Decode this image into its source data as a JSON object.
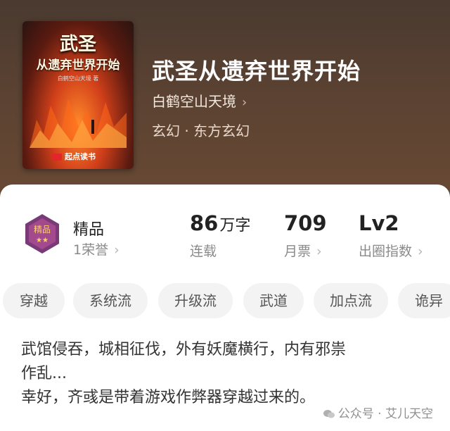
{
  "book": {
    "title": "武圣从遗弃世界开始",
    "author": "白鹤空山天境",
    "genre": "玄幻 · 东方玄幻",
    "cover": {
      "title_line1": "武圣",
      "title_line2": "从遗弃世界开始",
      "author": "白鹤空山天境 著",
      "publisher": "起点读书"
    }
  },
  "stats": {
    "badge_label": "精品",
    "honor": "1荣誉",
    "word_count_value": "86",
    "word_count_unit": "万字",
    "word_count_status": "连载",
    "monthly_tickets_value": "709",
    "monthly_tickets_label": "月票",
    "level_value": "Lv2",
    "level_label": "出圈指数"
  },
  "tags": [
    "穿越",
    "系统流",
    "升级流",
    "武道",
    "加点流",
    "诡异"
  ],
  "description": {
    "line1": "武馆侵吞，城相征伐，外有妖魔横行，内有邪祟",
    "line2": "作乱...",
    "line3": "幸好，齐彧是带着游戏作弊器穿越过来的。"
  },
  "watermark": "公众号 · 艾儿天空",
  "colors": {
    "hero_bg": "#5b4232",
    "tag_bg": "#f3f3f3",
    "badge_purple": "#7a3a78"
  }
}
